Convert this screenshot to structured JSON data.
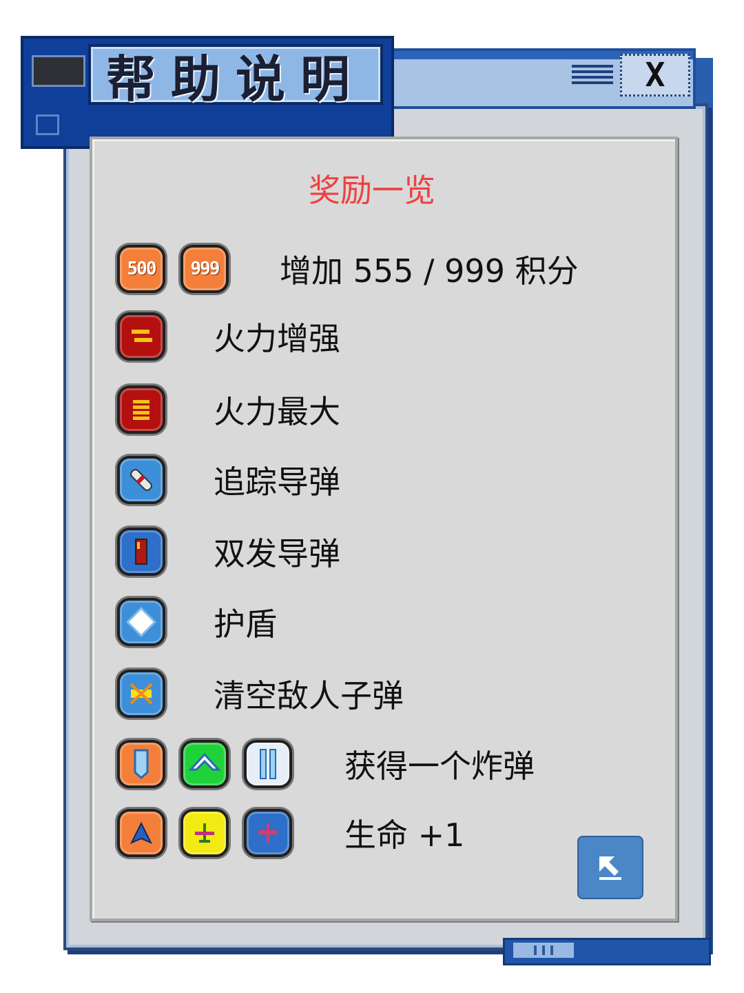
{
  "window": {
    "title": "帮助说明",
    "close_label": "X"
  },
  "panel": {
    "heading": "奖励一览",
    "heading_color": "#ef4040",
    "rows": [
      {
        "label": "增加 555 / 999 积分",
        "icons": [
          {
            "name": "score-500-icon",
            "text": "500"
          },
          {
            "name": "score-999-icon",
            "text": "999"
          }
        ]
      },
      {
        "label": "火力增强",
        "icons": [
          {
            "name": "firepower-up-icon"
          }
        ]
      },
      {
        "label": "火力最大",
        "icons": [
          {
            "name": "firepower-max-icon"
          }
        ]
      },
      {
        "label": "追踪导弹",
        "icons": [
          {
            "name": "homing-missile-icon"
          }
        ]
      },
      {
        "label": "双发导弹",
        "icons": [
          {
            "name": "double-missile-icon"
          }
        ]
      },
      {
        "label": "护盾",
        "icons": [
          {
            "name": "shield-icon"
          }
        ]
      },
      {
        "label": "清空敌人子弹",
        "icons": [
          {
            "name": "clear-bullets-icon"
          }
        ]
      },
      {
        "label": "获得一个炸弹",
        "icons": [
          {
            "name": "bomb-orange-icon"
          },
          {
            "name": "bomb-green-icon"
          },
          {
            "name": "bomb-white-icon"
          }
        ]
      },
      {
        "label": "生命 +1",
        "icons": [
          {
            "name": "life-orange-icon"
          },
          {
            "name": "life-yellow-icon"
          },
          {
            "name": "life-blue-icon"
          }
        ]
      }
    ]
  },
  "back_button": {
    "icon": "arrow-up-left-icon"
  }
}
